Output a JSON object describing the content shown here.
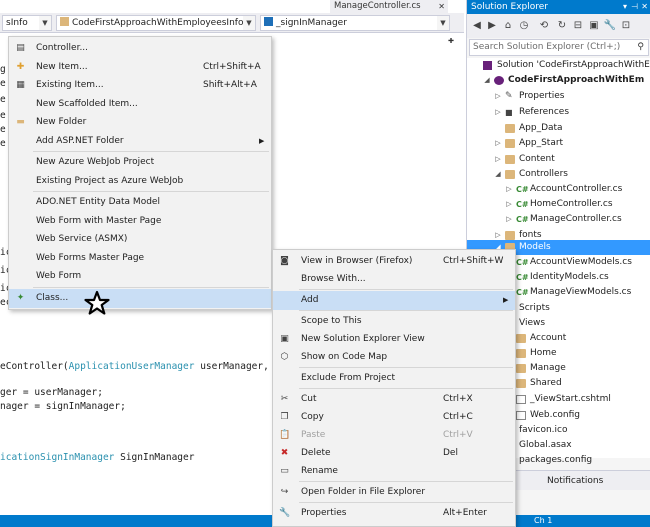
{
  "editor": {
    "doc_tab": "ManageController.cs",
    "nav": {
      "combo1": "sInfo",
      "combo2": "CodeFirstApproachWithEmployeesInfo.Con",
      "combo3": "_signInManager"
    },
    "lines": [
      {
        "plain": "eController(",
        "type1": "ApplicationUserManager",
        "rest": " userManager,"
      },
      {
        "plain": "ger = userManager;"
      },
      {
        "plain": "nager = signInManager;"
      },
      {
        "type1": "icationSignInManager",
        "rest": " SignInManager"
      }
    ],
    "left_fragments": [
      "g",
      "e",
      "e",
      "e",
      "e",
      "e",
      "ic",
      "ic",
      "ic",
      "ec"
    ]
  },
  "statusbar": {
    "position": "Ch 1"
  },
  "solution_explorer": {
    "title": "Solution Explorer",
    "search_placeholder": "Search Solution Explorer (Ctrl+;)",
    "items": [
      {
        "label": "Solution 'CodeFirstApproachWithEm",
        "depth": 0,
        "icon": "solution-icon",
        "arrow": ""
      },
      {
        "label": "CodeFirstApproachWithEm",
        "depth": 1,
        "icon": "project-icon",
        "arrow": "open",
        "bold": true
      },
      {
        "label": "Properties",
        "depth": 2,
        "icon": "wrench-icon",
        "arrow": "closed"
      },
      {
        "label": "References",
        "depth": 2,
        "icon": "references-icon",
        "arrow": "closed"
      },
      {
        "label": "App_Data",
        "depth": 2,
        "icon": "folder-icon",
        "arrow": ""
      },
      {
        "label": "App_Start",
        "depth": 2,
        "icon": "folder-icon",
        "arrow": "closed"
      },
      {
        "label": "Content",
        "depth": 2,
        "icon": "folder-icon",
        "arrow": "closed"
      },
      {
        "label": "Controllers",
        "depth": 2,
        "icon": "folder-icon",
        "arrow": "open"
      },
      {
        "label": "AccountController.cs",
        "depth": 3,
        "icon": "cs-file-icon",
        "arrow": "closed"
      },
      {
        "label": "HomeController.cs",
        "depth": 3,
        "icon": "cs-file-icon",
        "arrow": "closed"
      },
      {
        "label": "ManageController.cs",
        "depth": 3,
        "icon": "cs-file-icon",
        "arrow": "closed"
      },
      {
        "label": "fonts",
        "depth": 2,
        "icon": "folder-icon",
        "arrow": "closed"
      },
      {
        "label": "Models",
        "depth": 2,
        "icon": "folder-icon",
        "arrow": "open",
        "selected": true
      },
      {
        "label": "AccountViewModels.cs",
        "depth": 3,
        "icon": "cs-file-icon",
        "arrow": "closed"
      },
      {
        "label": "IdentityModels.cs",
        "depth": 3,
        "icon": "cs-file-icon",
        "arrow": "closed"
      },
      {
        "label": "ManageViewModels.cs",
        "depth": 3,
        "icon": "cs-file-icon",
        "arrow": "closed"
      },
      {
        "label": "Scripts",
        "depth": 2,
        "icon": "folder-icon",
        "arrow": "closed"
      },
      {
        "label": "Views",
        "depth": 2,
        "icon": "folder-icon",
        "arrow": "open"
      },
      {
        "label": "Account",
        "depth": 3,
        "icon": "folder-icon",
        "arrow": ""
      },
      {
        "label": "Home",
        "depth": 3,
        "icon": "folder-icon",
        "arrow": ""
      },
      {
        "label": "Manage",
        "depth": 3,
        "icon": "folder-icon",
        "arrow": ""
      },
      {
        "label": "Shared",
        "depth": 3,
        "icon": "folder-icon",
        "arrow": ""
      },
      {
        "label": "_ViewStart.cshtml",
        "depth": 3,
        "icon": "file-icon",
        "arrow": ""
      },
      {
        "label": "Web.config",
        "depth": 3,
        "icon": "config-icon",
        "arrow": ""
      },
      {
        "label": "favicon.ico",
        "depth": 2,
        "icon": "file-icon",
        "arrow": ""
      },
      {
        "label": "Global.asax",
        "depth": 2,
        "icon": "file-icon",
        "arrow": "closed"
      },
      {
        "label": "packages.config",
        "depth": 2,
        "icon": "config-icon",
        "arrow": ""
      }
    ],
    "bottom_tabs": [
      "xplorer",
      "Notifications"
    ]
  },
  "add_menu": {
    "items": [
      {
        "label": "Controller...",
        "shortcut": "",
        "icon": "controller-icon"
      },
      {
        "label": "New Item...",
        "shortcut": "Ctrl+Shift+A",
        "icon": "new-item-icon"
      },
      {
        "label": "Existing Item...",
        "shortcut": "Shift+Alt+A",
        "icon": "existing-item-icon"
      },
      {
        "label": "New Scaffolded Item...",
        "shortcut": "",
        "icon": ""
      },
      {
        "label": "New Folder",
        "shortcut": "",
        "icon": "folder-icon"
      },
      {
        "label": "Add ASP.NET Folder",
        "shortcut": "",
        "icon": "",
        "submenu": true
      },
      {
        "sep": true
      },
      {
        "label": "New Azure WebJob Project",
        "shortcut": "",
        "icon": ""
      },
      {
        "label": "Existing Project as Azure WebJob",
        "shortcut": "",
        "icon": ""
      },
      {
        "sep": true
      },
      {
        "label": "ADO.NET Entity Data Model",
        "shortcut": "",
        "icon": ""
      },
      {
        "label": "Web Form with Master Page",
        "shortcut": "",
        "icon": ""
      },
      {
        "label": "Web Service (ASMX)",
        "shortcut": "",
        "icon": ""
      },
      {
        "label": "Web Forms Master Page",
        "shortcut": "",
        "icon": ""
      },
      {
        "label": "Web Form",
        "shortcut": "",
        "icon": ""
      },
      {
        "sep": true
      },
      {
        "label": "Class...",
        "shortcut": "",
        "icon": "class-icon",
        "highlight": true
      }
    ]
  },
  "context_menu": {
    "items": [
      {
        "label": "View in Browser (Firefox)",
        "shortcut": "Ctrl+Shift+W",
        "icon": "browser-icon"
      },
      {
        "label": "Browse With...",
        "shortcut": "",
        "icon": ""
      },
      {
        "sep": true
      },
      {
        "label": "Add",
        "shortcut": "",
        "icon": "",
        "submenu": true,
        "highlight": true
      },
      {
        "sep": true
      },
      {
        "label": "Scope to This",
        "shortcut": "",
        "icon": ""
      },
      {
        "label": "New Solution Explorer View",
        "shortcut": "",
        "icon": "new-view-icon"
      },
      {
        "label": "Show on Code Map",
        "shortcut": "",
        "icon": "code-map-icon"
      },
      {
        "sep": true
      },
      {
        "label": "Exclude From Project",
        "shortcut": "",
        "icon": ""
      },
      {
        "sep": true
      },
      {
        "label": "Cut",
        "shortcut": "Ctrl+X",
        "icon": "scissors-icon"
      },
      {
        "label": "Copy",
        "shortcut": "Ctrl+C",
        "icon": "copy-icon"
      },
      {
        "label": "Paste",
        "shortcut": "Ctrl+V",
        "icon": "paste-icon",
        "disabled": true
      },
      {
        "label": "Delete",
        "shortcut": "Del",
        "icon": "delete-icon"
      },
      {
        "label": "Rename",
        "shortcut": "",
        "icon": "rename-icon"
      },
      {
        "sep": true
      },
      {
        "label": "Open Folder in File Explorer",
        "shortcut": "",
        "icon": "open-folder-icon"
      },
      {
        "sep": true
      },
      {
        "label": "Properties",
        "shortcut": "Alt+Enter",
        "icon": "wrench-icon"
      }
    ]
  },
  "colors": {
    "accent": "#007acc",
    "selection": "#3399ff",
    "menu_highlight": "#c9def5",
    "type": "#2b91af",
    "keyword": "#0000ff"
  }
}
